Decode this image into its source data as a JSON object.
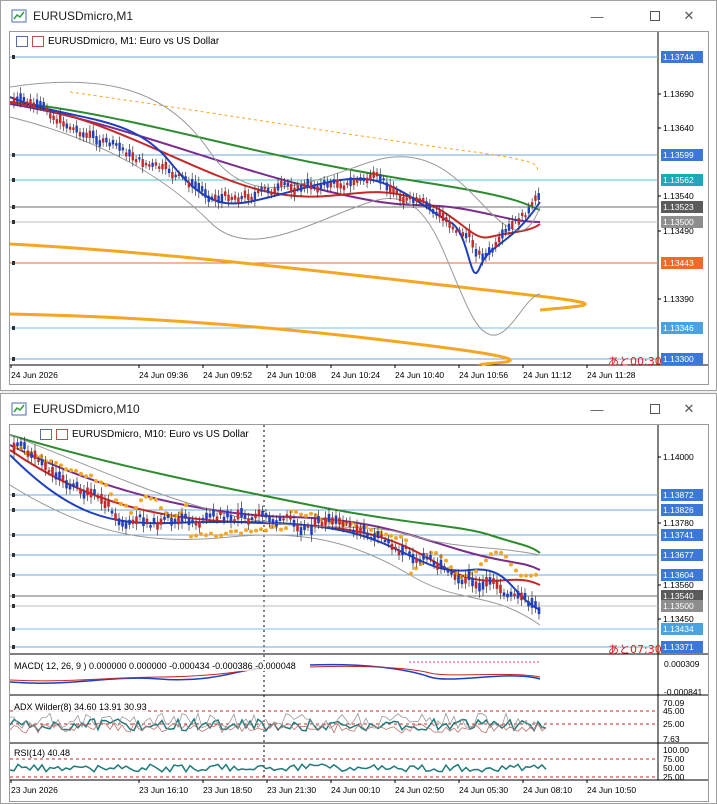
{
  "windows": [
    {
      "title": "EURUSDmicro,M1",
      "header": "EURUSDmicro, M1:  Euro vs US Dollar",
      "countdown": "あと00:30",
      "yticks": [
        "1.13690",
        "1.13640",
        "1.13540",
        "1.13490",
        "1.13390"
      ],
      "hlines": [
        {
          "label": "1.13744",
          "color": "#3c78d8",
          "line": "#6fa8dc"
        },
        {
          "label": "1.13599",
          "color": "#3c78d8",
          "line": "#6fa8dc"
        },
        {
          "label": "1.13562",
          "color": "#1fa6b8",
          "line": "#4fc3d0"
        },
        {
          "label": "1.13523",
          "color": "#5b5b5b",
          "line": "#6d6d6d"
        },
        {
          "label": "1.13500",
          "color": "#8e8e8e",
          "line": "#bdbdbd"
        },
        {
          "label": "1.13443",
          "color": "#f06a2c",
          "line": "#f06a2c"
        },
        {
          "label": "1.13346",
          "color": "#4aa3e0",
          "line": "#7cc0ee"
        },
        {
          "label": "1.13300",
          "color": "#3c78d8",
          "line": "#6fa8dc"
        }
      ],
      "xticks": [
        "24 Jun 2026",
        "24 Jun 09:36",
        "24 Jun 09:52",
        "24 Jun 10:08",
        "24 Jun 10:24",
        "24 Jun 10:40",
        "24 Jun 10:56",
        "24 Jun 11:12",
        "24 Jun 11:28"
      ]
    },
    {
      "title": "EURUSDmicro,M10",
      "header": "EURUSDmicro, M10:  Euro vs US Dollar",
      "countdown": "あと07:30",
      "yticks": [
        "1.14000",
        "1.13780",
        "1.13560",
        "1.13450",
        "1.13500"
      ],
      "hlines": [
        {
          "label": "1.13872",
          "color": "#3c78d8",
          "line": "#6fa8dc"
        },
        {
          "label": "1.13826",
          "color": "#3c78d8",
          "line": "#6fa8dc"
        },
        {
          "label": "1.13741",
          "color": "#3c78d8",
          "line": "#6fa8dc"
        },
        {
          "label": "1.13677",
          "color": "#3c78d8",
          "line": "#6fa8dc"
        },
        {
          "label": "1.13604",
          "color": "#3c78d8",
          "line": "#6fa8dc"
        },
        {
          "label": "1.13540",
          "color": "#5b5b5b",
          "line": "#6d6d6d"
        },
        {
          "label": "1.13500",
          "color": "#8e8e8e",
          "line": "#bdbdbd"
        },
        {
          "label": "1.13434",
          "color": "#4aa3e0",
          "line": "#7cc0ee"
        },
        {
          "label": "1.13371",
          "color": "#3c78d8",
          "line": "#6fa8dc"
        }
      ],
      "macd": {
        "label": "MACD( 12, 26, 9 ) 0.000000 0.000000 -0.000434 -0.000386 -0.000048",
        "top": "0.000309",
        "bottom": "-0.000841"
      },
      "adx": {
        "label": "ADX Wilder(8) 34.60 13.91 30.93",
        "ticks": [
          "70.09",
          "45.00",
          "25.00",
          "7.63"
        ]
      },
      "rsi": {
        "label": "RSI(14) 40.48",
        "ticks": [
          "100.00",
          "75.00",
          "50.00",
          "25.00"
        ]
      },
      "xticks": [
        "23 Jun 2026",
        "23 Jun 16:10",
        "23 Jun 18:50",
        "23 Jun 21:30",
        "24 Jun 00:10",
        "24 Jun 02:50",
        "24 Jun 05:30",
        "24 Jun 08:10",
        "24 Jun 10:50"
      ]
    }
  ]
}
